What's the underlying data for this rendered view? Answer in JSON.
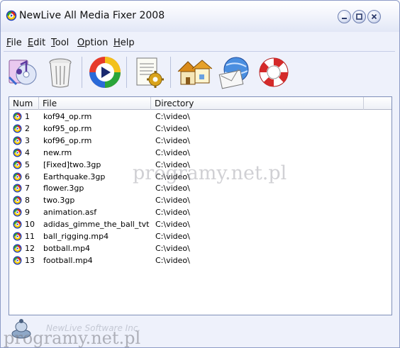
{
  "window": {
    "title": "NewLive All Media Fixer 2008"
  },
  "menu": {
    "items": [
      {
        "label": "File",
        "accel": "F"
      },
      {
        "label": "Edit",
        "accel": "E"
      },
      {
        "label": "Tool",
        "accel": "T"
      },
      {
        "label": "Option",
        "accel": "O"
      },
      {
        "label": "Help",
        "accel": "H"
      }
    ]
  },
  "toolbar": {
    "buttons": [
      {
        "name": "add-media-button",
        "icon": "media-files-icon"
      },
      {
        "name": "delete-button",
        "icon": "trash-bin-icon"
      },
      {
        "name": "fix-button",
        "icon": "media-player-icon"
      },
      {
        "name": "settings-button",
        "icon": "document-gear-icon"
      },
      {
        "name": "home-button",
        "icon": "houses-icon"
      },
      {
        "name": "email-button",
        "icon": "email-globe-icon"
      },
      {
        "name": "help-button",
        "icon": "lifebuoy-icon"
      }
    ]
  },
  "list": {
    "columns": [
      "Num",
      "File",
      "Directory"
    ],
    "rows": [
      {
        "num": "1",
        "file": "kof94_op.rm",
        "dir": "C:\\video\\"
      },
      {
        "num": "2",
        "file": "kof95_op.rm",
        "dir": "C:\\video\\"
      },
      {
        "num": "3",
        "file": "kof96_op.rm",
        "dir": "C:\\video\\"
      },
      {
        "num": "4",
        "file": "new.rm",
        "dir": "C:\\video\\"
      },
      {
        "num": "5",
        "file": "[Fixed]two.3gp",
        "dir": "C:\\video\\"
      },
      {
        "num": "6",
        "file": "Earthquake.3gp",
        "dir": "C:\\video\\"
      },
      {
        "num": "7",
        "file": "flower.3gp",
        "dir": "C:\\video\\"
      },
      {
        "num": "8",
        "file": "two.3gp",
        "dir": "C:\\video\\"
      },
      {
        "num": "9",
        "file": "animation.asf",
        "dir": "C:\\video\\"
      },
      {
        "num": "10",
        "file": "adidas_gimme_the_ball_tvtal...",
        "dir": "C:\\video\\"
      },
      {
        "num": "11",
        "file": "ball_rigging.mp4",
        "dir": "C:\\video\\"
      },
      {
        "num": "12",
        "file": "botball.mp4",
        "dir": "C:\\video\\"
      },
      {
        "num": "13",
        "file": "football.mp4",
        "dir": "C:\\video\\"
      }
    ]
  },
  "footer": {
    "company": "NewLive Software Inc."
  },
  "watermark": {
    "text": "programy.net.pl"
  }
}
